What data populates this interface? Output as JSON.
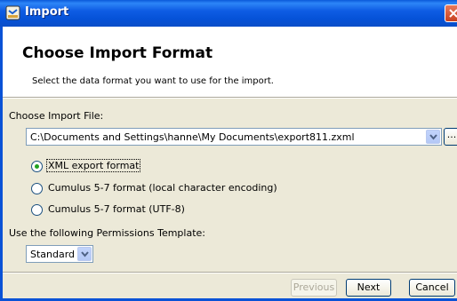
{
  "window": {
    "title": "Import"
  },
  "header": {
    "title": "Choose Import Format",
    "subtitle": "Select the data format you want to use for the import."
  },
  "import_file": {
    "label": "Choose Import File:",
    "value": "C:\\Documents and Settings\\hanne\\My Documents\\export811.zxml",
    "browse_label": "..."
  },
  "formats": [
    {
      "label": "XML export format",
      "selected": true
    },
    {
      "label": "Cumulus 5-7 format (local character encoding)",
      "selected": false
    },
    {
      "label": "Cumulus 5-7 format (UTF-8)",
      "selected": false
    }
  ],
  "permissions": {
    "label": "Use the following Permissions Template:",
    "value": "Standard"
  },
  "buttons": {
    "previous": "Previous",
    "next": "Next",
    "cancel": "Cancel"
  },
  "colors": {
    "titlebar": "#0a59d9",
    "dialog_bg": "#ece9d8",
    "radio_selected": "#21a121",
    "close_button": "#c7401f"
  },
  "icons": [
    "app-icon",
    "close-icon",
    "chevron-down-icon"
  ]
}
